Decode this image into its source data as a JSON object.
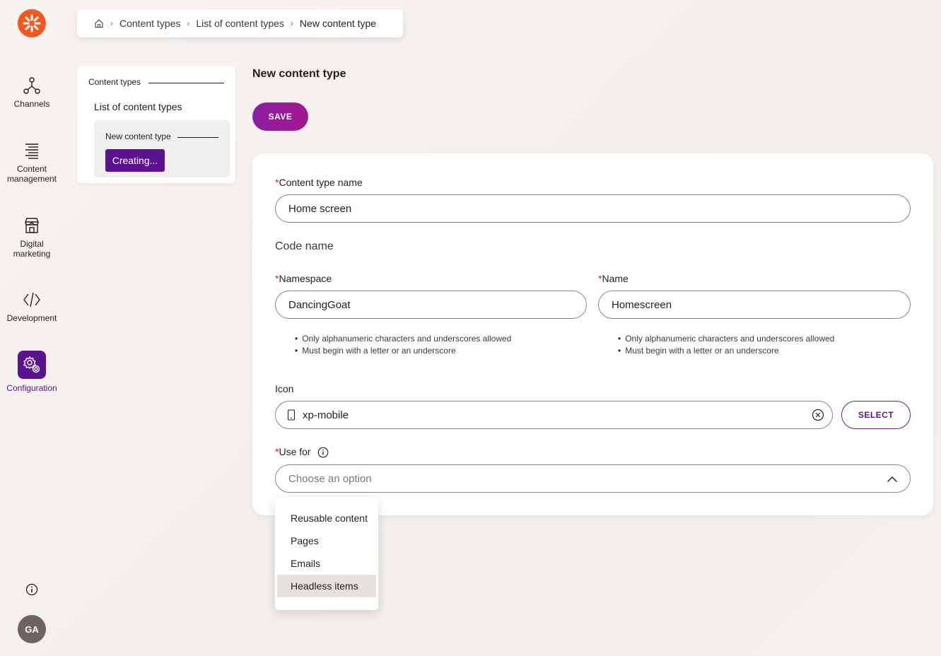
{
  "rail": {
    "items": [
      {
        "label_line1": "Channels",
        "label_line2": "",
        "icon": "channels-icon"
      },
      {
        "label_line1": "Content",
        "label_line2": "management",
        "icon": "content-management-icon"
      },
      {
        "label_line1": "Digital",
        "label_line2": "marketing",
        "icon": "digital-marketing-icon"
      },
      {
        "label_line1": "Development",
        "label_line2": "",
        "icon": "code-icon"
      },
      {
        "label_line1": "Configuration",
        "label_line2": "",
        "icon": "gear-icon"
      }
    ],
    "avatar_initials": "GA"
  },
  "breadcrumb": {
    "items": [
      "Content types",
      "List of content types"
    ],
    "current": "New content type"
  },
  "tree": {
    "level1": "Content types",
    "level2": "List of content types",
    "level3": "New content type",
    "status_button": "Creating..."
  },
  "page": {
    "title": "New content type",
    "save_label": "SAVE"
  },
  "form": {
    "content_type_name": {
      "label": "Content type name",
      "value": "Home screen"
    },
    "code_name_heading": "Code name",
    "namespace": {
      "label": "Namespace",
      "value": "DancingGoat"
    },
    "name": {
      "label": "Name",
      "value": "Homescreen"
    },
    "hints": [
      "Only alphanumeric characters and underscores allowed",
      "Must begin with a letter or an underscore"
    ],
    "icon": {
      "label": "Icon",
      "value": "xp-mobile",
      "select_label": "SELECT"
    },
    "use_for": {
      "label": "Use for",
      "placeholder": "Choose an option",
      "options": [
        "Reusable content",
        "Pages",
        "Emails",
        "Headless items"
      ]
    }
  },
  "colors": {
    "accent": "#5b1391",
    "logo": "#f05a22",
    "required": "#c0282d"
  }
}
